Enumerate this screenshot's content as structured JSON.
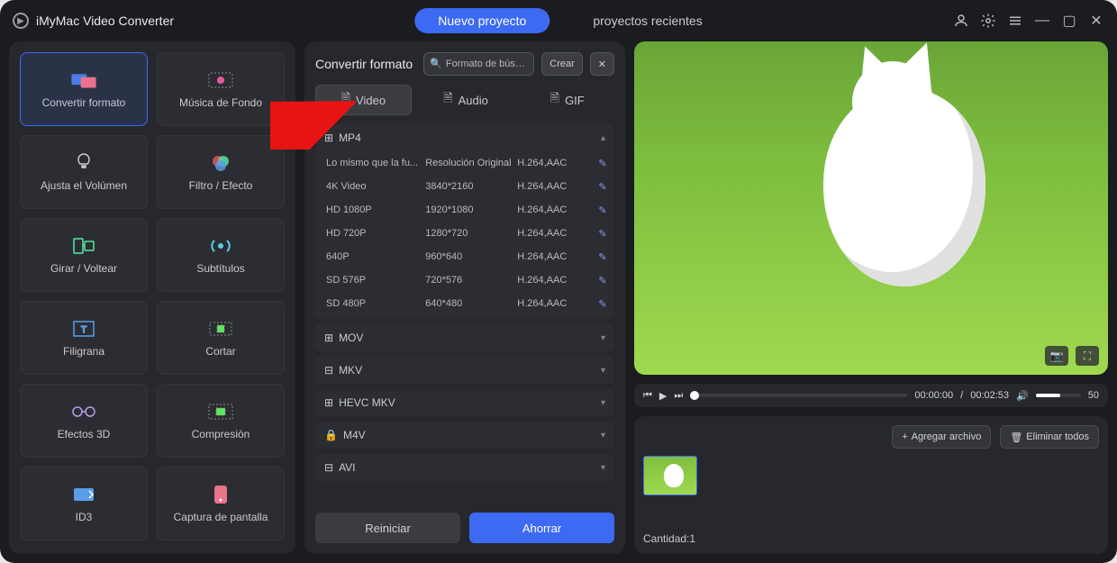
{
  "app": {
    "title": "iMyMac Video Converter"
  },
  "header": {
    "new_project": "Nuevo proyecto",
    "recent_projects": "proyectos recientes"
  },
  "sidebar": {
    "tools": [
      {
        "id": "convert",
        "label": "Convertir formato"
      },
      {
        "id": "bgmusic",
        "label": "Música de Fondo"
      },
      {
        "id": "volume",
        "label": "Ajusta el Volúmen"
      },
      {
        "id": "filter",
        "label": "Filtro / Efecto"
      },
      {
        "id": "rotate",
        "label": "Girar / Voltear"
      },
      {
        "id": "subtitles",
        "label": "Subtítulos"
      },
      {
        "id": "watermark",
        "label": "Filigrana"
      },
      {
        "id": "trim",
        "label": "Cortar"
      },
      {
        "id": "fx3d",
        "label": "Efectos 3D"
      },
      {
        "id": "compress",
        "label": "Compresión"
      },
      {
        "id": "id3",
        "label": "ID3"
      },
      {
        "id": "screencap",
        "label": "Captura de pantalla"
      }
    ]
  },
  "middle": {
    "title": "Convertir formato",
    "search_placeholder": "Formato de búsqued",
    "create_btn": "Crear",
    "tabs": {
      "video": "Video",
      "audio": "Audio",
      "gif": "GIF"
    },
    "expanded_group": "MP4",
    "groups": [
      "MP4",
      "MOV",
      "MKV",
      "HEVC MKV",
      "M4V",
      "AVI"
    ],
    "mp4_rows": [
      {
        "name": "Lo mismo que la fu...",
        "res": "Resolución Original",
        "codec": "H.264,AAC"
      },
      {
        "name": "4K Video",
        "res": "3840*2160",
        "codec": "H.264,AAC"
      },
      {
        "name": "HD 1080P",
        "res": "1920*1080",
        "codec": "H.264,AAC"
      },
      {
        "name": "HD 720P",
        "res": "1280*720",
        "codec": "H.264,AAC"
      },
      {
        "name": "640P",
        "res": "960*640",
        "codec": "H.264,AAC"
      },
      {
        "name": "SD 576P",
        "res": "720*576",
        "codec": "H.264,AAC"
      },
      {
        "name": "SD 480P",
        "res": "640*480",
        "codec": "H.264,AAC"
      }
    ],
    "reset_btn": "Reiniciar",
    "save_btn": "Ahorrar"
  },
  "player": {
    "time_current": "00:00:00",
    "time_total": "00:02:53",
    "volume_value": "50"
  },
  "files": {
    "add_btn": "Agregar archivo",
    "remove_all_btn": "Eliminar todos",
    "count_label": "Cantidad:",
    "count_value": "1"
  }
}
